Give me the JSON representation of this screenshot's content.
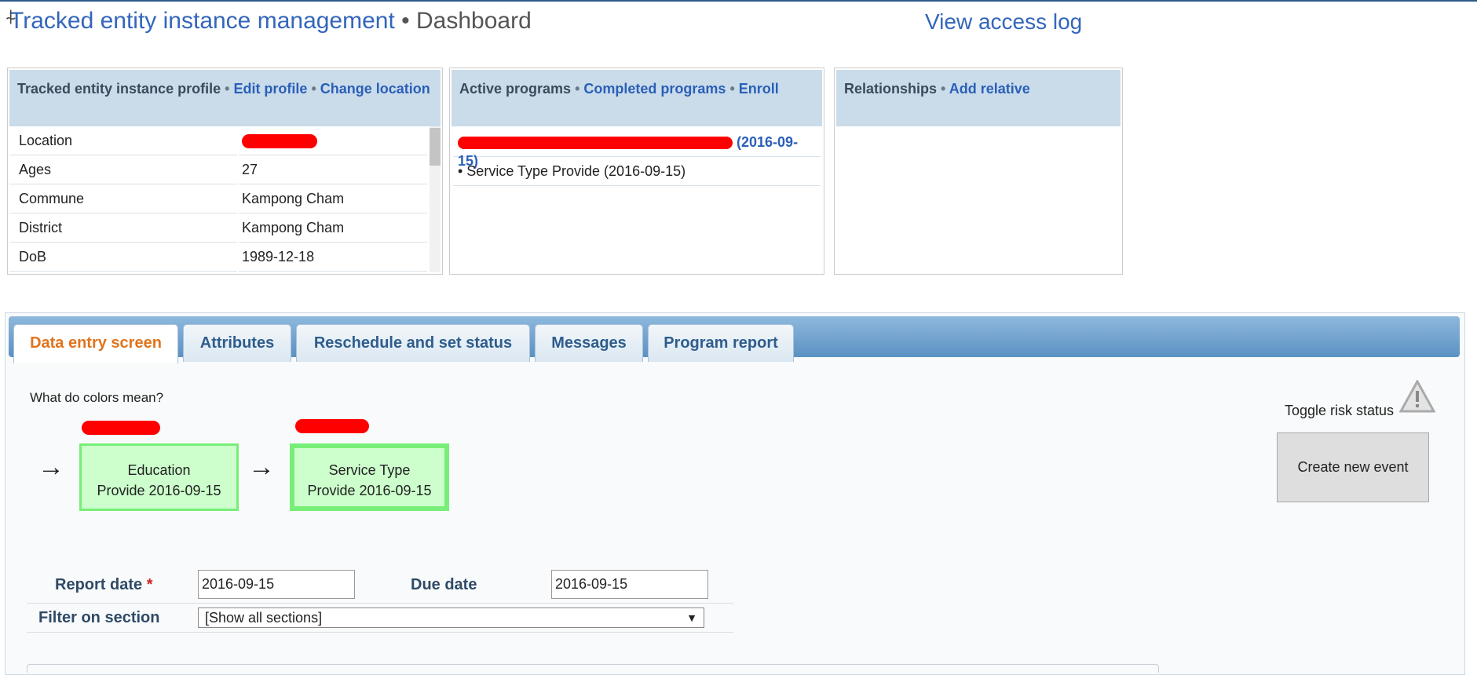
{
  "header": {
    "title_link": "Tracked entity instance management",
    "separator": "•",
    "page": "Dashboard",
    "access_log": "View access log"
  },
  "profile_panel": {
    "title": "Tracked entity instance profile",
    "edit": "Edit profile",
    "change_location": "Change location",
    "rows": [
      {
        "label": "Location",
        "value": ""
      },
      {
        "label": "Ages",
        "value": "27"
      },
      {
        "label": "Commune",
        "value": "Kampong Cham"
      },
      {
        "label": "District",
        "value": "Kampong Cham"
      },
      {
        "label": "DoB",
        "value": "1989-12-18"
      }
    ]
  },
  "programs_panel": {
    "title": "Active programs",
    "completed": "Completed programs",
    "enroll": "Enroll",
    "active_program_date": "(2016-09-15)",
    "stage_item": "• Service Type Provide (2016-09-15)"
  },
  "relationships_panel": {
    "title": "Relationships",
    "add": "Add relative"
  },
  "tabs": [
    {
      "label": "Data entry screen"
    },
    {
      "label": "Attributes"
    },
    {
      "label": "Reschedule and set status"
    },
    {
      "label": "Messages"
    },
    {
      "label": "Program report"
    }
  ],
  "entry": {
    "colors_question": "What do colors mean?",
    "arrow": "→",
    "stages": [
      {
        "line1": "Education",
        "line2": "Provide 2016-09-15"
      },
      {
        "line1": "Service Type",
        "line2": "Provide 2016-09-15"
      }
    ],
    "toggle_risk": "Toggle risk status",
    "create_event": "Create new event",
    "report_date_label": "Report date",
    "required_mark": "*",
    "report_date_value": "2016-09-15",
    "due_date_label": "Due date",
    "due_date_value": "2016-09-15",
    "filter_label": "Filter on section",
    "filter_value": "[Show all sections]"
  },
  "colors": {
    "link": "#3366bb",
    "active_tab": "#e0741c",
    "stage_fill": "#ccffcc",
    "stage_border": "#77ee77",
    "panel_head": "#cadcea"
  }
}
